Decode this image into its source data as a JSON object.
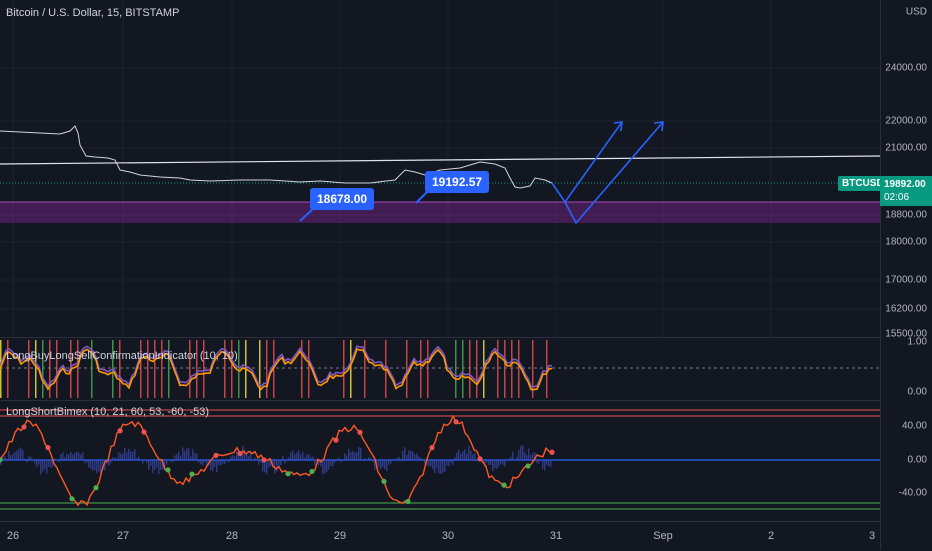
{
  "symbol_title": "Bitcoin / U.S. Dollar, 15, BITSTAMP",
  "currency": "USD",
  "price_axis": [
    "24000.00",
    "22000.00",
    "21000.00",
    "18800.00",
    "18000.00",
    "17000.00",
    "16200.00",
    "15500.00"
  ],
  "ticker_label": "BTCUSD",
  "last_price": "19892.00",
  "countdown": "02:06",
  "callouts": {
    "low": "18678.00",
    "high": "19192.57"
  },
  "indicator1": {
    "title": "LongBuyLongSellConfirmationIndicator (10, 10)",
    "axis": [
      "1.00",
      "0.00"
    ]
  },
  "indicator2": {
    "title": "LongShortBimex (10, 21, 60, 53, -60, -53)",
    "axis": [
      "40.00",
      "0.00",
      "-40.00"
    ]
  },
  "time_axis": [
    "26",
    "27",
    "28",
    "29",
    "30",
    "31",
    "Sep",
    "2",
    "3"
  ],
  "colors": {
    "background": "#131722",
    "accent_blue": "#2962ff",
    "zone_purple": "#9c27b0",
    "price_green": "#089981",
    "candle_green": "#26a69a",
    "candle_red": "#ef5350",
    "osc_orange": "#ff9800"
  }
}
